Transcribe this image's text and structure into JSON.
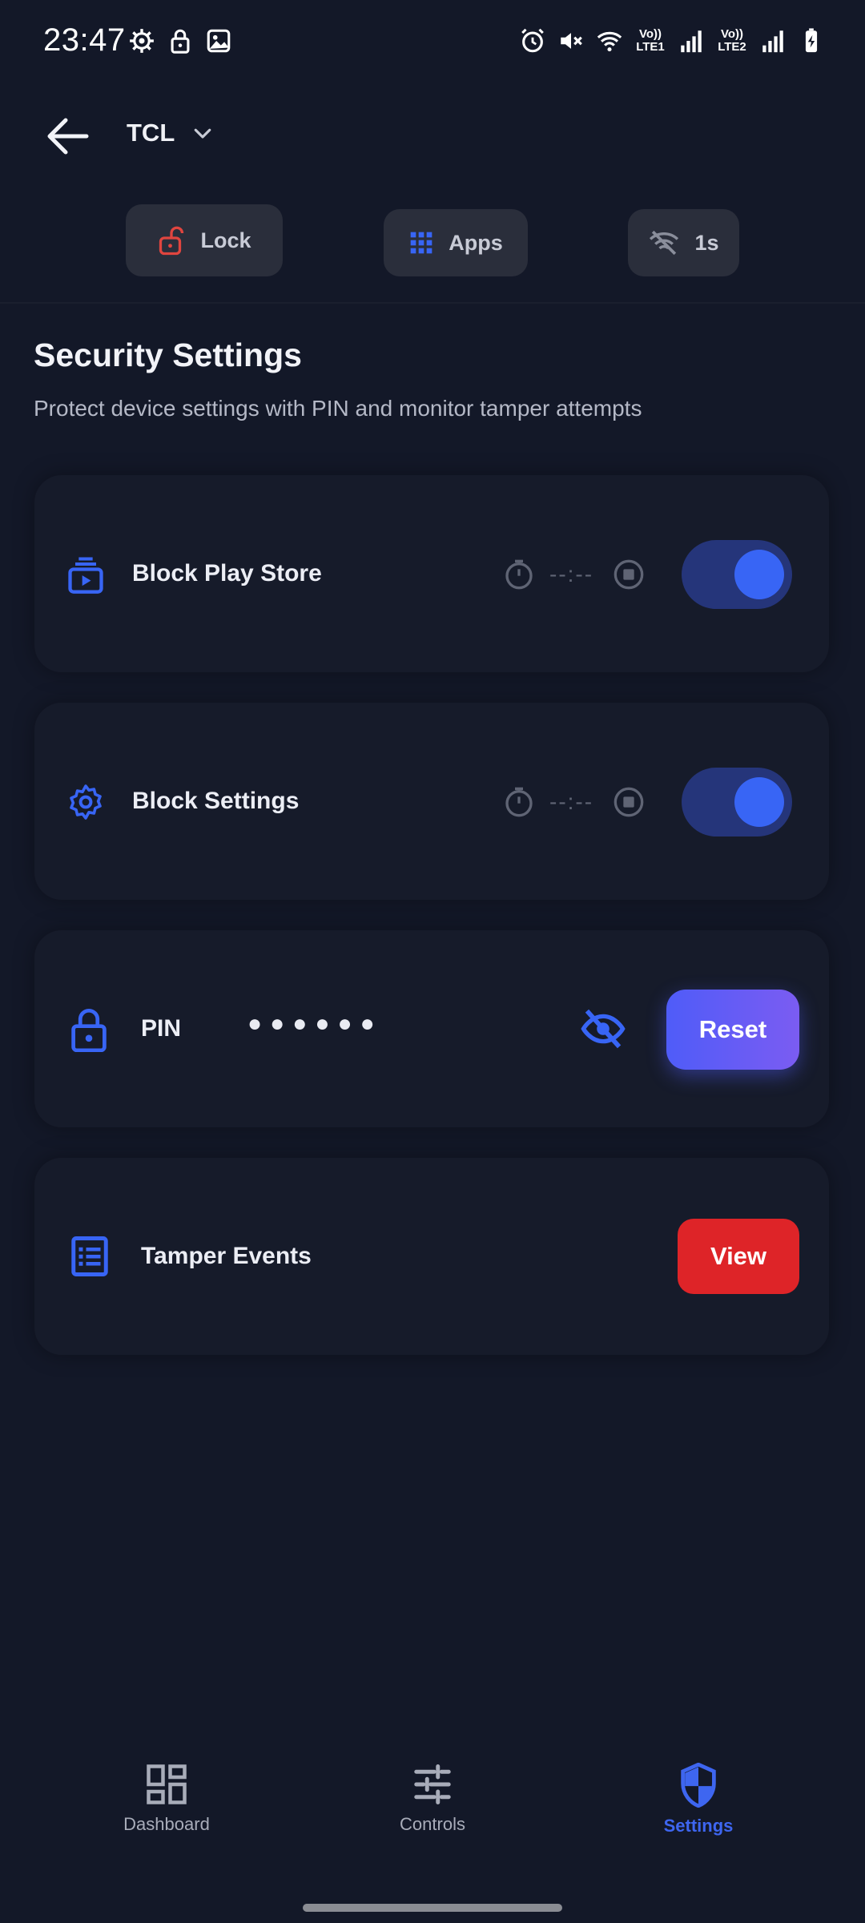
{
  "status_bar": {
    "time": "23:47",
    "sim1": "Vo)) LTE1",
    "sim2": "Vo)) LTE2"
  },
  "header": {
    "device_name": "TCL"
  },
  "quick_actions": {
    "lock_label": "Lock",
    "apps_label": "Apps",
    "wifi_label": "1s"
  },
  "section": {
    "title": "Security Settings",
    "subtitle": "Protect device settings with PIN and monitor tamper attempts"
  },
  "cards": {
    "play_store": {
      "label": "Block Play Store",
      "timer": "--:--",
      "enabled": true
    },
    "settings": {
      "label": "Block Settings",
      "timer": "--:--",
      "enabled": true
    },
    "pin": {
      "label": "PIN",
      "masked_value": "●●●●●●",
      "button_label": "Reset"
    },
    "tamper": {
      "label": "Tamper Events",
      "button_label": "View"
    }
  },
  "bottom_nav": {
    "items": [
      {
        "label": "Dashboard",
        "icon": "dashboard-icon",
        "active": false
      },
      {
        "label": "Controls",
        "icon": "sliders-icon",
        "active": false
      },
      {
        "label": "Settings",
        "icon": "shield-icon",
        "active": true
      }
    ]
  },
  "colors": {
    "background": "#131828",
    "card": "#161b2a",
    "accent": "#3865f5",
    "danger": "#de2428",
    "lock_red": "#e0453f"
  }
}
